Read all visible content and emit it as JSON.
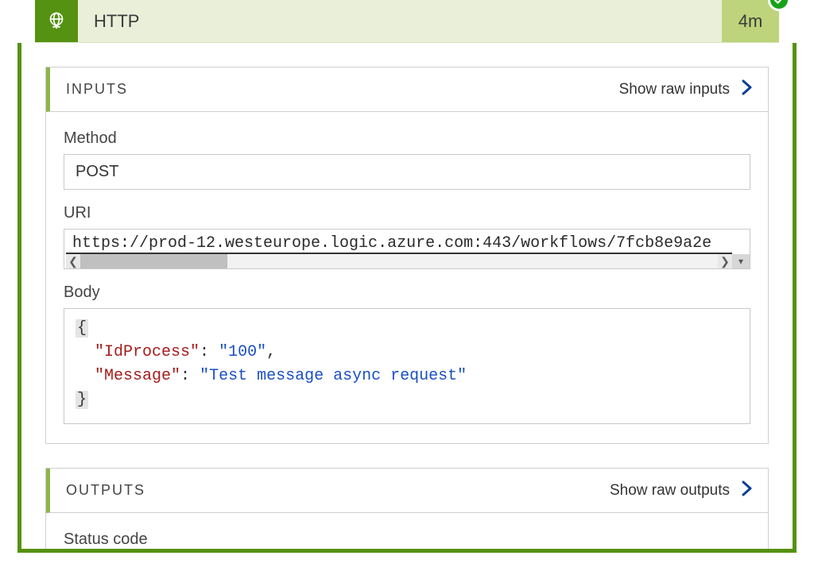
{
  "step": {
    "title": "HTTP",
    "duration": "4m",
    "status": "success"
  },
  "inputs": {
    "panel_title": "INPUTS",
    "show_raw_label": "Show raw inputs",
    "method_label": "Method",
    "method_value": "POST",
    "uri_label": "URI",
    "uri_value": "https://prod-12.westeurope.logic.azure.com:443/workflows/7fcb8e9a2e",
    "body_label": "Body",
    "body_json": {
      "IdProcess": "100",
      "Message": "Test message async request"
    }
  },
  "outputs": {
    "panel_title": "OUTPUTS",
    "show_raw_label": "Show raw outputs",
    "status_code_label": "Status code"
  }
}
